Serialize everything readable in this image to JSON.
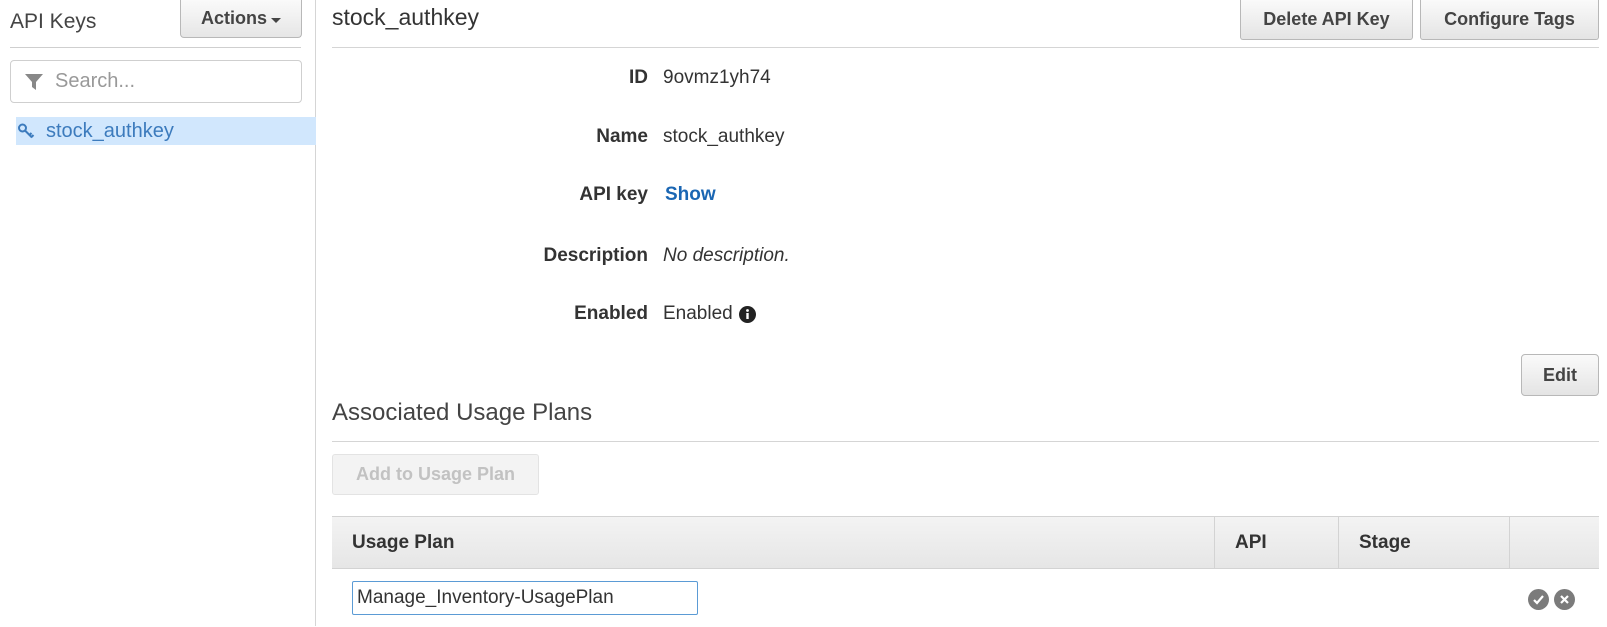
{
  "sidebar": {
    "title": "API Keys",
    "actions_label": "Actions",
    "search_placeholder": "Search...",
    "items": [
      {
        "label": "stock_authkey",
        "selected": true
      }
    ]
  },
  "main": {
    "title": "stock_authkey",
    "delete_label": "Delete API Key",
    "configure_tags_label": "Configure Tags",
    "details": {
      "id_label": "ID",
      "id_value": "9ovmz1yh74",
      "name_label": "Name",
      "name_value": "stock_authkey",
      "api_key_label": "API key",
      "api_key_value": "Show",
      "description_label": "Description",
      "description_value": "No description.",
      "enabled_label": "Enabled",
      "enabled_value": "Enabled"
    },
    "edit_label": "Edit"
  },
  "usage_plans": {
    "title": "Associated Usage Plans",
    "add_label": "Add to Usage Plan",
    "columns": [
      "Usage Plan",
      "API",
      "Stage",
      ""
    ],
    "rows": [
      {
        "plan_input_value": "Manage_Inventory-UsagePlan",
        "api": "",
        "stage": ""
      }
    ]
  },
  "colors": {
    "accent_link": "#1a66b3",
    "selected_bg": "#d1e7fd",
    "selected_text": "#3c7bbd"
  },
  "icons": [
    "filter-icon",
    "key-icon",
    "info-icon",
    "check-icon",
    "close-icon"
  ]
}
